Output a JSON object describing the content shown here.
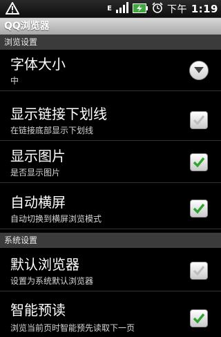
{
  "status_bar": {
    "carrier_icon": "E",
    "time_prefix": "下午",
    "time": "1:19"
  },
  "app": {
    "title": "QQ浏览器"
  },
  "sections": {
    "browse": {
      "title": "浏览设置"
    },
    "system": {
      "title": "系统设置"
    }
  },
  "settings": {
    "font_size": {
      "title": "字体大小",
      "value": "中"
    },
    "underline_links": {
      "title": "显示链接下划线",
      "subtitle": "在链接底部显示下划线",
      "checked": false
    },
    "show_images": {
      "title": "显示图片",
      "subtitle": "是否显示图片",
      "checked": true
    },
    "auto_rotate": {
      "title": "自动横屏",
      "subtitle": "自动切换到横屏浏览模式",
      "checked": true
    },
    "default_browser": {
      "title": "默认浏览器",
      "subtitle": "设置为系统默认浏览器",
      "checked": false
    },
    "smart_preload": {
      "title": "智能预读",
      "subtitle": "浏览当前页时智能预先读取下一页",
      "checked": true
    }
  },
  "colors": {
    "check_green": "#2fa52f",
    "check_gray": "#bdbdbd"
  }
}
